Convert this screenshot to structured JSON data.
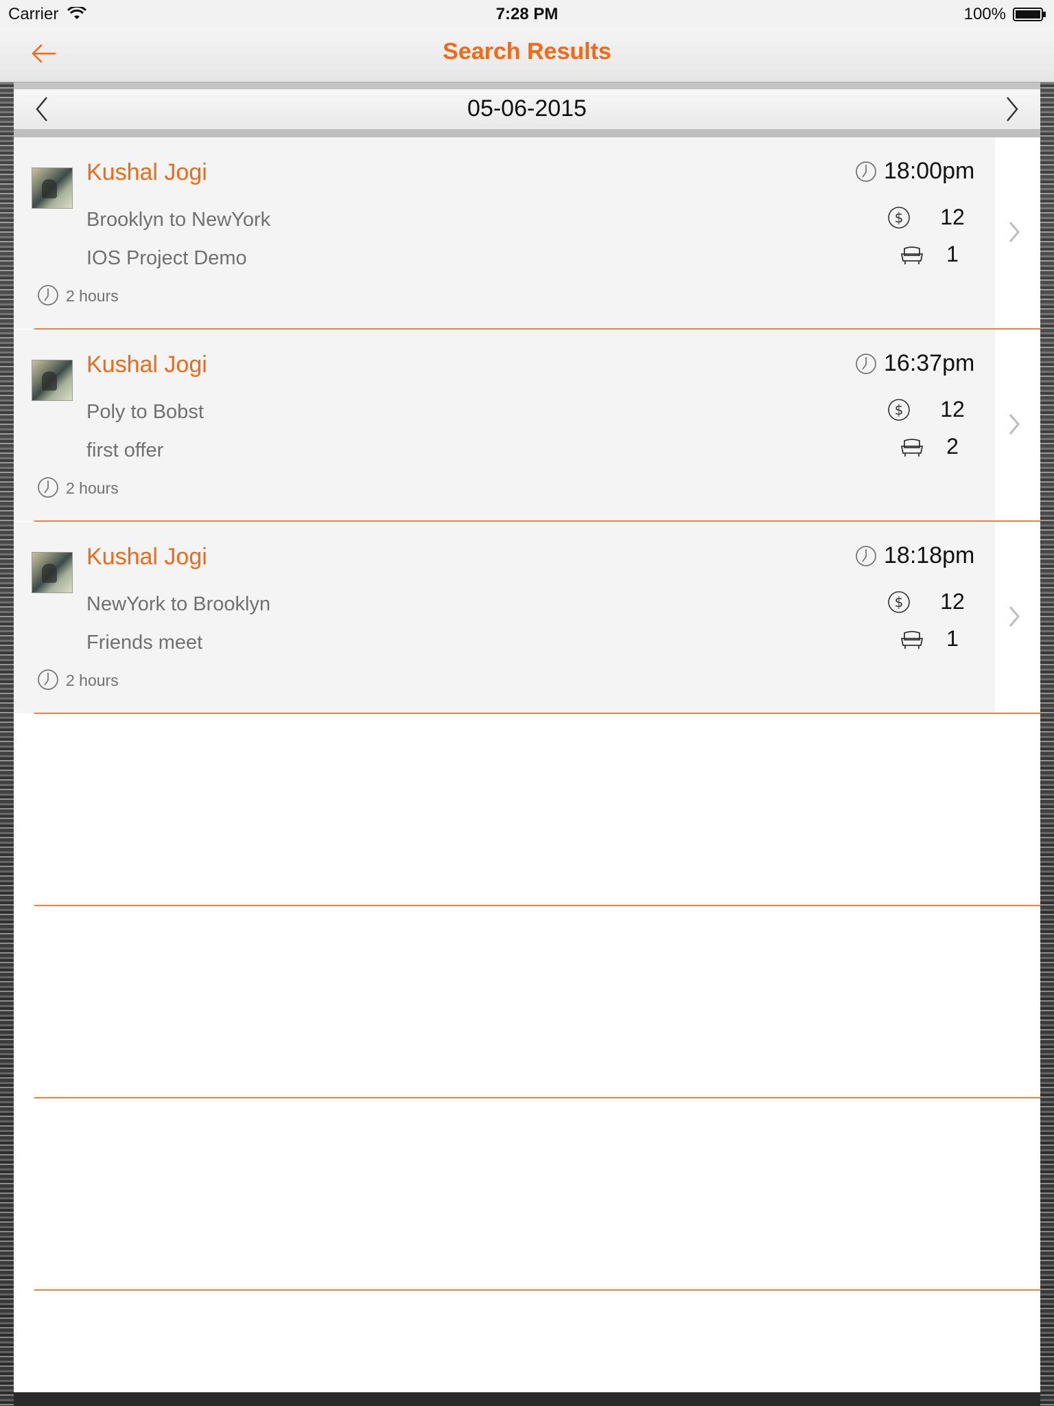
{
  "status_bar": {
    "carrier": "Carrier",
    "time": "7:28 PM",
    "battery": "100%"
  },
  "nav": {
    "title": "Search Results"
  },
  "date_bar": {
    "date": "05-06-2015"
  },
  "colors": {
    "accent": "#f26a16",
    "separator": "#f3803a",
    "secondary_text": "#707070"
  },
  "results": [
    {
      "name": "Kushal Jogi",
      "route": "Brooklyn to NewYork",
      "description": "IOS Project Demo",
      "duration": "2 hours",
      "time": "18:00pm",
      "price": "12",
      "seats": "1"
    },
    {
      "name": "Kushal Jogi",
      "route": "Poly to Bobst",
      "description": "first offer",
      "duration": "2 hours",
      "time": "16:37pm",
      "price": "12",
      "seats": "2"
    },
    {
      "name": "Kushal Jogi",
      "route": "NewYork to Brooklyn",
      "description": "Friends meet",
      "duration": "2 hours",
      "time": "18:18pm",
      "price": "12",
      "seats": "1"
    }
  ],
  "icons": {
    "back": "arrow-left-icon",
    "prev": "chevron-left-icon",
    "next": "chevron-right-icon",
    "clock": "clock-icon",
    "price": "dollar-icon",
    "seat": "seat-icon",
    "row_chevron": "chevron-right-icon"
  }
}
